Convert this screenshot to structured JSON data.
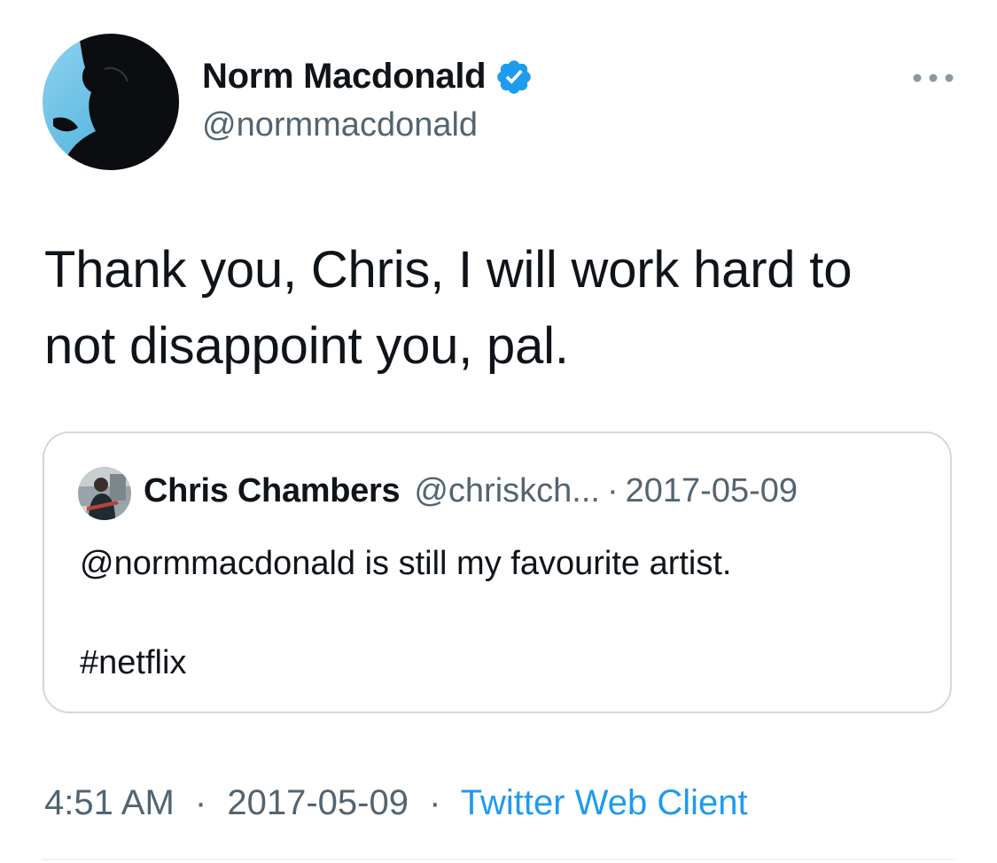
{
  "author": {
    "display_name": "Norm Macdonald",
    "handle": "@normmacdonald",
    "verified_icon": "verified-badge-icon",
    "avatar_icon": "avatar"
  },
  "tweet": {
    "text_lines": [
      "Thank you, Chris, I will work hard to",
      "not disappoint you, pal."
    ]
  },
  "quoted_tweet": {
    "display_name": "Chris Chambers",
    "handle": "@chriskch...",
    "separator": "·",
    "date": "2017-05-09",
    "text": "@normmacdonald is still my favourite artist.",
    "hashtag": "#netflix"
  },
  "metadata": {
    "time": "4:51 AM",
    "separator": "·",
    "date": "2017-05-09",
    "source": "Twitter Web Client"
  },
  "colors": {
    "text_primary": "#0f1419",
    "text_secondary": "#536471",
    "accent": "#1d9bf0",
    "border": "#cfd9de"
  }
}
